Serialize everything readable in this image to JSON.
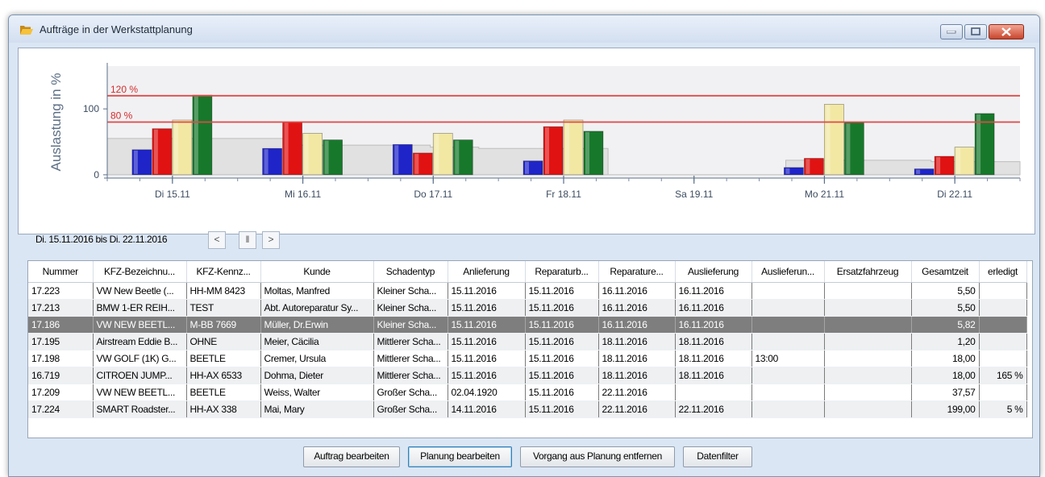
{
  "window": {
    "title": "Aufträge in der Werkstattplanung"
  },
  "icons": {
    "title": "folder-open-icon",
    "minimize": "minimize-icon",
    "maximize": "maximize-icon",
    "close": "close-icon",
    "prev": "chevron-left-icon",
    "pause": "pause-icon",
    "next": "chevron-right-icon"
  },
  "colors": {
    "blue": "#1f24c8",
    "red": "#e01212",
    "yellow": "#f2e8a4",
    "green": "#17782b",
    "area": "#e1e1e1",
    "threshold": "#e04848",
    "selection": "#7e7e7e"
  },
  "chart_data": {
    "type": "bar",
    "ylabel": "Auslastung in %",
    "ylim": [
      -5,
      165
    ],
    "yticks": [
      0,
      100
    ],
    "grid": false,
    "categories": [
      "Di 15.11",
      "Mi 16.11",
      "Do 17.11",
      "Fr 18.11",
      "Sa 19.11",
      "Mo 21.11",
      "Di 22.11"
    ],
    "series": [
      {
        "color": "blue",
        "values": [
          38,
          40,
          46,
          21,
          0,
          11,
          9
        ]
      },
      {
        "color": "red",
        "values": [
          70,
          80,
          33,
          73,
          0,
          25,
          28
        ]
      },
      {
        "color": "yellow",
        "values": [
          83,
          63,
          63,
          83,
          0,
          107,
          42
        ]
      },
      {
        "color": "green",
        "values": [
          121,
          53,
          53,
          66,
          0,
          79,
          93
        ]
      }
    ],
    "background_area": [
      55,
      55,
      55,
      55,
      55,
      55,
      55,
      55,
      55,
      55,
      55,
      55,
      55,
      55,
      55,
      55,
      55,
      55,
      55,
      55,
      55,
      55,
      55,
      55,
      45,
      45,
      45,
      45,
      45,
      45,
      45,
      45,
      45,
      45,
      45,
      45,
      45,
      45,
      45,
      45,
      42,
      42,
      42,
      42,
      42,
      42,
      40,
      40,
      40,
      40,
      40,
      40,
      40,
      40,
      40,
      40,
      40,
      40,
      40,
      40,
      40,
      40,
      0,
      0,
      0,
      0,
      0,
      0,
      0,
      0,
      0,
      0,
      0,
      0,
      0,
      0,
      0,
      0,
      0,
      0,
      0,
      0,
      0,
      0,
      22,
      22,
      22,
      22,
      22,
      22,
      22,
      22,
      22,
      22,
      22,
      22,
      22,
      22,
      22,
      22,
      22,
      22,
      20,
      20,
      20,
      20,
      20,
      20,
      20,
      20,
      20,
      20,
      20
    ],
    "lines": [
      {
        "label": "120 %",
        "value": 120
      },
      {
        "label": "80 %",
        "value": 80
      }
    ]
  },
  "range": {
    "text": "Di. 15.11.2016 bis Di. 22.11.2016",
    "prev": "<",
    "pause": "‖",
    "next": ">"
  },
  "table": {
    "columns": [
      "Nummer",
      "KFZ-Bezeichnu...",
      "KFZ-Kennz...",
      "Kunde",
      "Schadentyp",
      "Anlieferung",
      "Reparaturb...",
      "Reparature...",
      "Auslieferung",
      "Auslieferun...",
      "Ersatzfahrzeug",
      "Gesamtzeit",
      "erledigt"
    ],
    "rows": [
      [
        "17.223",
        "VW New Beetle (...",
        "HH-MM 8423",
        "Moltas, Manfred",
        "Kleiner Scha...",
        "15.11.2016",
        "15.11.2016",
        "16.11.2016",
        "16.11.2016",
        "",
        "",
        "5,50",
        ""
      ],
      [
        "17.213",
        "BMW 1-ER REIH...",
        "TEST",
        "Abt. Autoreparatur Sy...",
        "Kleiner Scha...",
        "15.11.2016",
        "15.11.2016",
        "16.11.2016",
        "16.11.2016",
        "",
        "",
        "5,50",
        ""
      ],
      [
        "17.186",
        "VW NEW BEETL...",
        "M-BB 7669",
        "Müller, Dr.Erwin",
        "Kleiner Scha...",
        "15.11.2016",
        "15.11.2016",
        "16.11.2016",
        "16.11.2016",
        "",
        "",
        "5,82",
        ""
      ],
      [
        "17.195",
        "Airstream Eddie B...",
        "OHNE",
        "Meier, Cäcilia",
        "Mittlerer Scha...",
        "15.11.2016",
        "15.11.2016",
        "18.11.2016",
        "18.11.2016",
        "",
        "",
        "1,20",
        ""
      ],
      [
        "17.198",
        "VW GOLF (1K) G...",
        "BEETLE",
        "Cremer, Ursula",
        "Mittlerer Scha...",
        "15.11.2016",
        "15.11.2016",
        "18.11.2016",
        "18.11.2016",
        "13:00",
        "",
        "18,00",
        ""
      ],
      [
        "16.719",
        "CITROEN JUMP...",
        "HH-AX 6533",
        "Dohma, Dieter",
        "Mittlerer Scha...",
        "15.11.2016",
        "15.11.2016",
        "18.11.2016",
        "18.11.2016",
        "",
        "",
        "18,00",
        "165 %"
      ],
      [
        "17.209",
        "VW NEW BEETL...",
        "BEETLE",
        "Weiss, Walter",
        "Großer Scha...",
        "02.04.1920",
        "15.11.2016",
        "22.11.2016",
        "",
        "",
        "",
        "37,57",
        ""
      ],
      [
        "17.224",
        "SMART Roadster...",
        "HH-AX 338",
        "Mai, Mary",
        "Großer Scha...",
        "14.11.2016",
        "15.11.2016",
        "22.11.2016",
        "22.11.2016",
        "",
        "",
        "199,00",
        "5 %"
      ]
    ],
    "selected_index": 2
  },
  "buttons": {
    "edit_order": "Auftrag bearbeiten",
    "edit_plan": "Planung bearbeiten",
    "remove": "Vorgang aus Planung entfernen",
    "filter": "Datenfilter"
  }
}
